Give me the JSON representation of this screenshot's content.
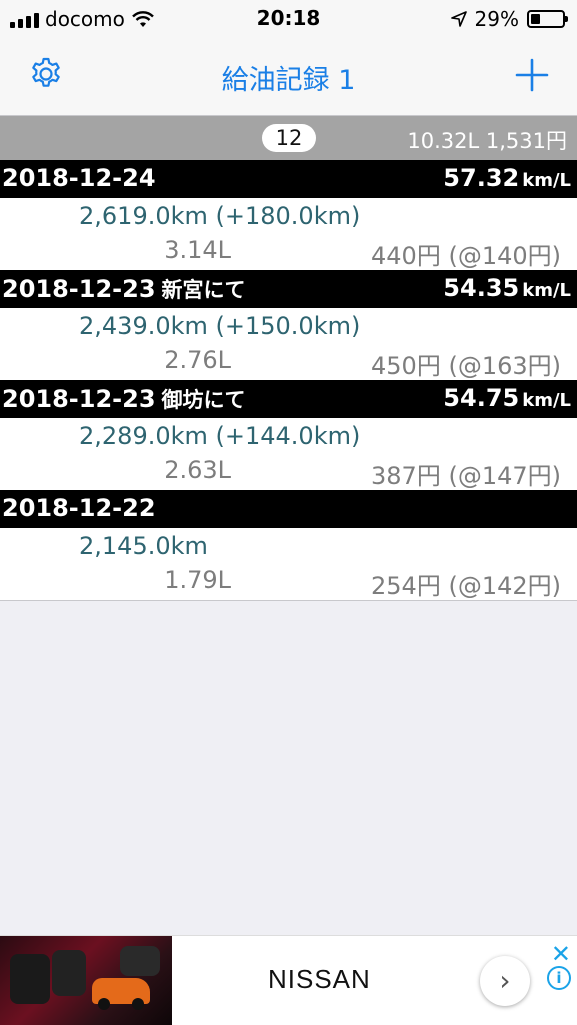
{
  "status_bar": {
    "carrier": "docomo",
    "time": "20:18",
    "battery_percent": "29%",
    "battery_level": 0.29
  },
  "nav": {
    "title": "給油記録 1",
    "left_icon": "gear-icon",
    "right_icon": "plus-icon",
    "accent_color": "#1a7fe6"
  },
  "summary": {
    "count": "12",
    "totals": "10.32L  1,531円"
  },
  "entries": [
    {
      "date": "2018-12-24",
      "place": "",
      "efficiency": "57.32",
      "unit": "km/L",
      "odometer": "2,619.0km (+180.0km)",
      "liters": "3.14L",
      "price": "440円 (@140円)"
    },
    {
      "date": "2018-12-23",
      "place": "新宮にて",
      "efficiency": "54.35",
      "unit": "km/L",
      "odometer": "2,439.0km (+150.0km)",
      "liters": "2.76L",
      "price": "450円 (@163円)"
    },
    {
      "date": "2018-12-23",
      "place": "御坊にて",
      "efficiency": "54.75",
      "unit": "km/L",
      "odometer": "2,289.0km (+144.0km)",
      "liters": "2.63L",
      "price": "387円 (@147円)"
    },
    {
      "date": "2018-12-22",
      "place": "",
      "efficiency": "",
      "unit": "",
      "odometer": "2,145.0km",
      "liters": "1.79L",
      "price": "254円 (@142円)"
    }
  ],
  "ad": {
    "brand": "NISSAN",
    "arrow": "›",
    "close": "✕",
    "info": "i"
  }
}
